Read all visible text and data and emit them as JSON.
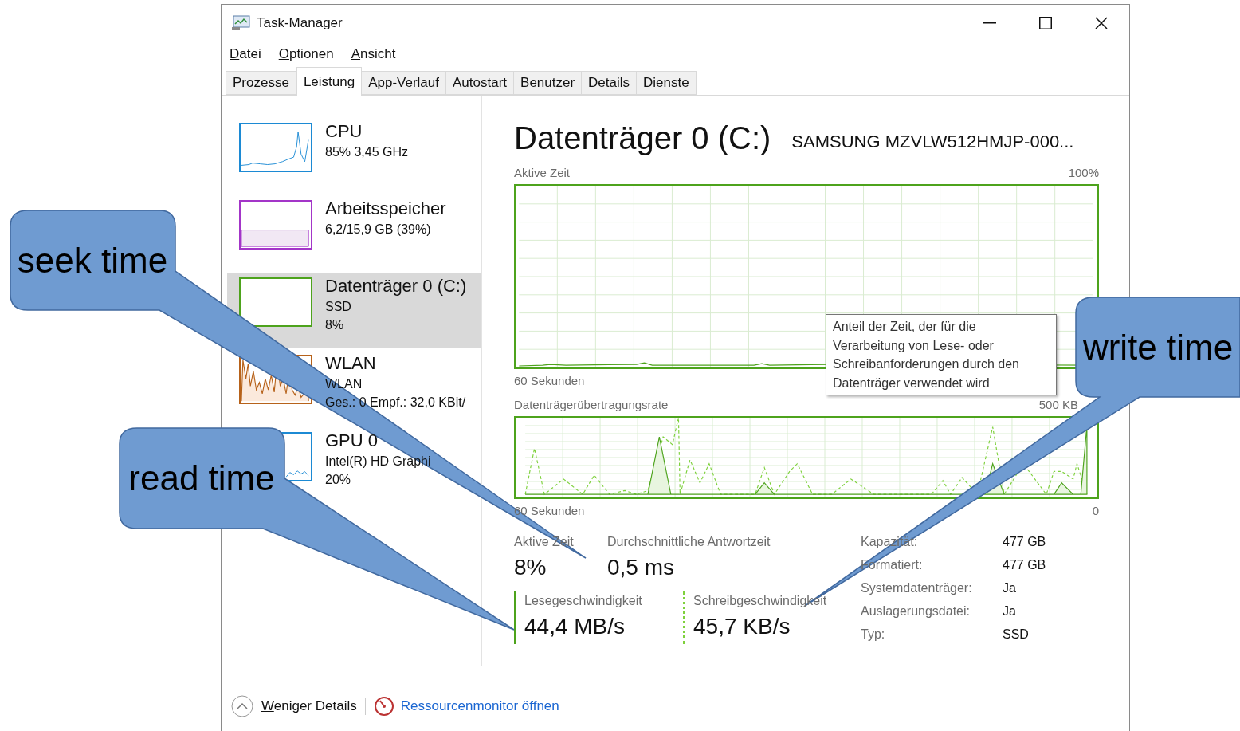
{
  "window": {
    "title": "Task-Manager"
  },
  "menu": [
    "Datei",
    "Optionen",
    "Ansicht"
  ],
  "tabs": [
    {
      "label": "Prozesse",
      "selected": false
    },
    {
      "label": "Leistung",
      "selected": true
    },
    {
      "label": "App-Verlauf",
      "selected": false
    },
    {
      "label": "Autostart",
      "selected": false
    },
    {
      "label": "Benutzer",
      "selected": false
    },
    {
      "label": "Details",
      "selected": false
    },
    {
      "label": "Dienste",
      "selected": false
    }
  ],
  "sidebar": {
    "items": [
      {
        "kind": "cpu",
        "color": "#1c8ad4",
        "title": "CPU",
        "lines": [
          "85% 3,45 GHz"
        ],
        "selected": false
      },
      {
        "kind": "memory",
        "color": "#a335c8",
        "title": "Arbeitsspeicher",
        "lines": [
          "6,2/15,9 GB (39%)"
        ],
        "selected": false
      },
      {
        "kind": "disk",
        "color": "#4da31c",
        "title": "Datenträger 0 (C:)",
        "lines": [
          "SSD",
          "8%"
        ],
        "selected": true
      },
      {
        "kind": "network",
        "color": "#b7621a",
        "title": "WLAN",
        "lines": [
          "WLAN",
          "Ges.: 0 Empf.: 32,0 KBit/"
        ],
        "selected": false
      },
      {
        "kind": "gpu",
        "color": "#1c8ad4",
        "title": "GPU 0",
        "lines": [
          "Intel(R) HD Graphi",
          "20%"
        ],
        "selected": false
      }
    ]
  },
  "detail": {
    "title": "Datenträger 0 (C:)",
    "model": "SAMSUNG MZVLW512HMJP-000...",
    "active_chart": {
      "label": "Aktive Zeit",
      "max": "100%",
      "time": "60 Sekunden"
    },
    "transfer_chart": {
      "label": "Datenträgerübertragungsrate",
      "max": "500 KB",
      "time": "60 Sekunden",
      "min": "0"
    },
    "tooltip": "Anteil der Zeit, der für die Verarbeitung von Lese- oder Schreibanforderungen durch den Datenträger verwendet wird",
    "stats": [
      {
        "kind": "plain",
        "label": "Aktive Zeit",
        "value": "8%"
      },
      {
        "kind": "plain",
        "label": "Durchschnittliche Antwortzeit",
        "value": "0,5 ms"
      },
      {
        "kind": "read",
        "label": "Lesegeschwindigkeit",
        "value": "44,4 MB/s"
      },
      {
        "kind": "write",
        "label": "Schreibgeschwindigkeit",
        "value": "45,7 KB/s"
      }
    ],
    "properties": [
      {
        "label": "Kapazität:",
        "value": "477 GB"
      },
      {
        "label": "Formatiert:",
        "value": "477 GB"
      },
      {
        "label": "Systemdatenträger:",
        "value": "Ja"
      },
      {
        "label": "Auslagerungsdatei:",
        "value": "Ja"
      },
      {
        "label": "Typ:",
        "value": "SSD"
      }
    ]
  },
  "footer": {
    "less_details": "Weniger Details",
    "resource_monitor": "Ressourcenmonitor öffnen"
  },
  "callouts": [
    {
      "text": "seek time"
    },
    {
      "text": "read time"
    },
    {
      "text": "write time"
    }
  ]
}
